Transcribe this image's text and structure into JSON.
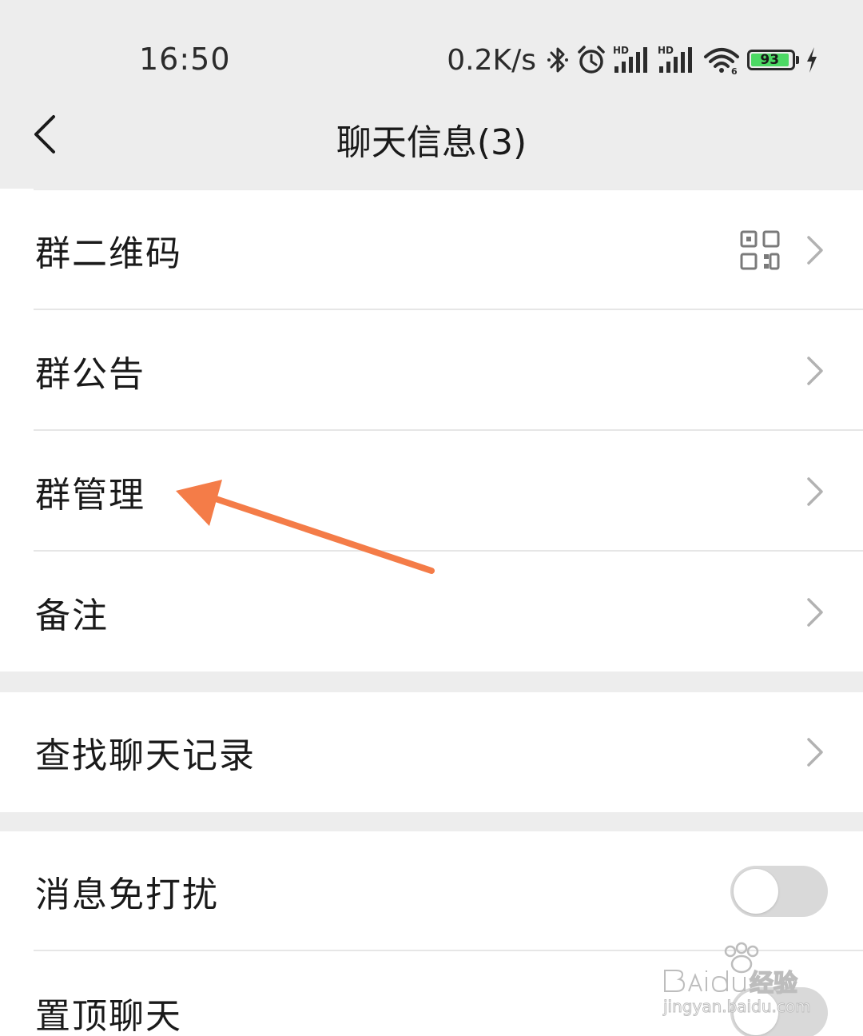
{
  "status_bar": {
    "time": "16:50",
    "net_speed": "0.2K/s",
    "battery_level": "93",
    "battery_fraction": 0.93,
    "icons": [
      "bluetooth-icon",
      "alarm-icon",
      "hd-signal-icon",
      "hd-signal-icon",
      "wifi-icon",
      "battery-icon",
      "charging-icon"
    ]
  },
  "nav": {
    "title": "聊天信息(3)",
    "back_icon": "chevron-left-icon"
  },
  "settings": {
    "group_qr": {
      "label": "群二维码",
      "icon": "qr-code-icon"
    },
    "group_notice": {
      "label": "群公告"
    },
    "group_manage": {
      "label": "群管理"
    },
    "remark": {
      "label": "备注"
    },
    "search_history": {
      "label": "查找聊天记录"
    },
    "mute": {
      "label": "消息免打扰",
      "enabled": false
    },
    "pin": {
      "label": "置顶聊天",
      "enabled": false
    }
  },
  "annotation": {
    "type": "arrow",
    "color": "#f47c48",
    "points_to": "群管理"
  },
  "watermark": {
    "brand": "Baidu经验",
    "domain": "jingyan.baidu.com"
  },
  "colors": {
    "background": "#ededed",
    "card": "#ffffff",
    "divider": "#e6e6e6",
    "toggle_off": "#d9d9d9",
    "battery_fill": "#4cd964",
    "arrow": "#f47c48"
  }
}
